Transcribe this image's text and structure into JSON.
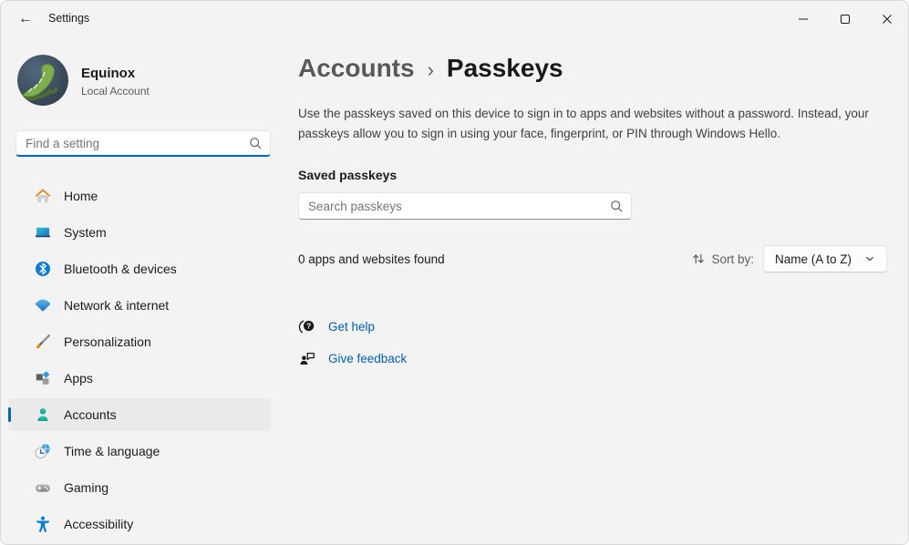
{
  "titlebar": {
    "title": "Settings",
    "back_icon": "left-arrow",
    "controls": {
      "minimize": "minimize",
      "maximize": "maximize",
      "close": "close"
    }
  },
  "user": {
    "name": "Equinox",
    "account_type": "Local Account",
    "avatar": "green-caterpillar-photo"
  },
  "sidebar": {
    "search_placeholder": "Find a setting",
    "items": [
      {
        "label": "Home",
        "icon": "home-icon",
        "selected": false
      },
      {
        "label": "System",
        "icon": "system-icon",
        "selected": false
      },
      {
        "label": "Bluetooth & devices",
        "icon": "bluetooth-icon",
        "selected": false
      },
      {
        "label": "Network & internet",
        "icon": "network-icon",
        "selected": false
      },
      {
        "label": "Personalization",
        "icon": "personalization-icon",
        "selected": false
      },
      {
        "label": "Apps",
        "icon": "apps-icon",
        "selected": false
      },
      {
        "label": "Accounts",
        "icon": "accounts-icon",
        "selected": true
      },
      {
        "label": "Time & language",
        "icon": "time-language-icon",
        "selected": false
      },
      {
        "label": "Gaming",
        "icon": "gaming-icon",
        "selected": false
      },
      {
        "label": "Accessibility",
        "icon": "accessibility-icon",
        "selected": false
      }
    ]
  },
  "main": {
    "breadcrumb": {
      "parent": "Accounts",
      "separator": "›",
      "current": "Passkeys"
    },
    "description": "Use the passkeys saved on this device to sign in to apps and websites without a password. Instead, your passkeys allow you to sign in using your face, fingerprint, or PIN through Windows Hello.",
    "section_label": "Saved passkeys",
    "search_placeholder": "Search passkeys",
    "results_text": "0 apps and websites found",
    "sort": {
      "label": "Sort by:",
      "value": "Name (A to Z)",
      "icon": "sort-arrows-icon"
    },
    "links": [
      {
        "label": "Get help",
        "icon": "get-help-icon"
      },
      {
        "label": "Give feedback",
        "icon": "give-feedback-icon"
      }
    ]
  },
  "colors": {
    "accent": "#0067C0",
    "link": "#005FB8",
    "background": "#F3F3F3",
    "selected_item": "#EAEAEA",
    "search_underline": "#0067C0"
  }
}
